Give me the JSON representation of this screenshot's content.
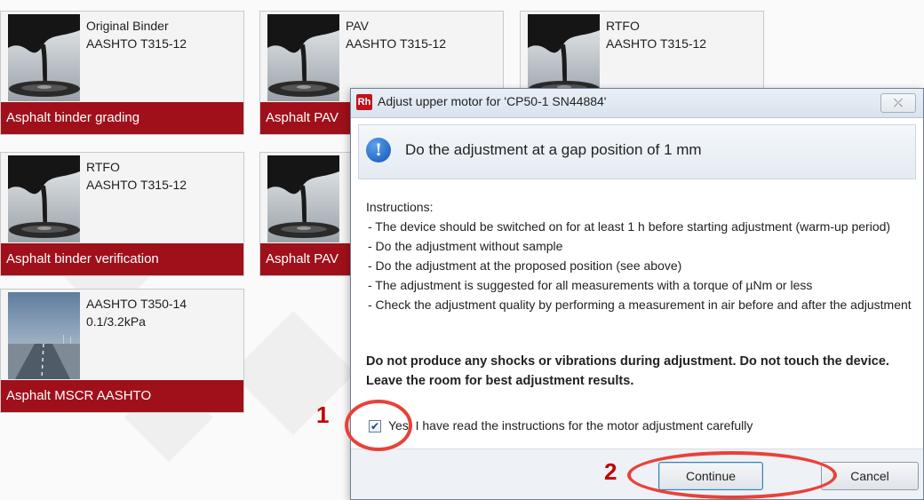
{
  "tiles": [
    {
      "line1": "Original Binder",
      "line2": "AASHTO T315-12",
      "label": "Asphalt binder grading",
      "thumb": "asphalt-drip"
    },
    {
      "line1": "PAV",
      "line2": "AASHTO T315-12",
      "label": "Asphalt PAV",
      "thumb": "asphalt-drip"
    },
    {
      "line1": "RTFO",
      "line2": "AASHTO T315-12",
      "label": "",
      "thumb": "asphalt-drip"
    },
    {
      "line1": "RTFO",
      "line2": "AASHTO T315-12",
      "label": "Asphalt binder verification",
      "thumb": "asphalt-drip"
    },
    {
      "line1": "",
      "line2": "",
      "label": "Asphalt PAV",
      "thumb": "asphalt-drip"
    },
    {
      "line1": "AASHTO T350-14",
      "line2": "0.1/3.2kPa",
      "label": "Asphalt MSCR AASHTO",
      "thumb": "road"
    }
  ],
  "dialog": {
    "app_icon_text": "Rh",
    "title": "Adjust upper motor for 'CP50-1 SN44884'",
    "close_glyph": "⤫",
    "headline": "Do the adjustment at a gap position of 1 mm",
    "instructions_heading": "Instructions:",
    "instructions": [
      "- The device should be switched on for at least 1 h before starting adjustment (warm-up period)",
      "- Do the adjustment without sample",
      "- Do the adjustment at the proposed position (see above)",
      "- The adjustment is suggested for all measurements with a torque of µNm or less",
      "- Check the adjustment quality by performing a measurement in air before and after the adjustment"
    ],
    "warning_lines": [
      "Do not produce any shocks or vibrations during adjustment. Do not touch the device.",
      "Leave the room for best adjustment results."
    ],
    "confirm_label": "Yes, I have read the instructions for the motor adjustment carefully",
    "confirm_checked": true,
    "continue_label": "Continue",
    "cancel_label": "Cancel"
  },
  "annotations": {
    "step1": "1",
    "step2": "2",
    "color": "#c00000"
  },
  "colors": {
    "tile_label_bg": "#a0101a",
    "dialog_border": "#6f7f93",
    "accent_blue": "#1454b4"
  }
}
